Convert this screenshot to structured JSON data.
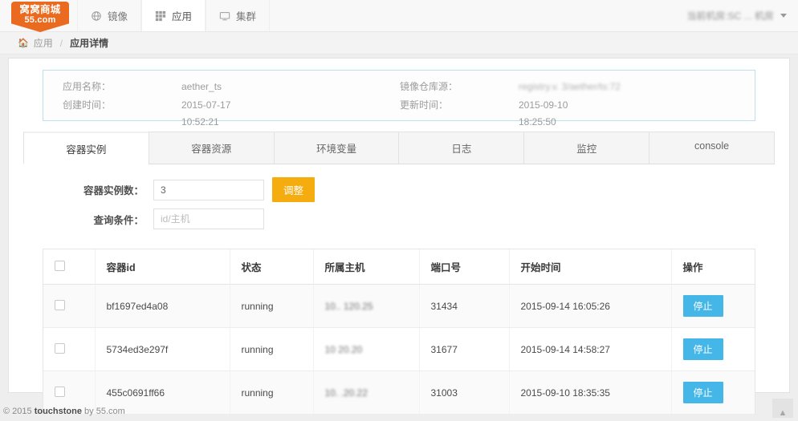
{
  "navbar": {
    "logo": {
      "line1": "窝窝商城",
      "line2": "55.com",
      "color": "#ea6a1f"
    },
    "items": [
      {
        "label": "镜像",
        "icon": "globe-icon",
        "active": false
      },
      {
        "label": "应用",
        "icon": "apps-grid-icon",
        "active": true
      },
      {
        "label": "集群",
        "icon": "monitor-icon",
        "active": false
      }
    ],
    "right": {
      "label": "当前机房:SC ... 机房",
      "icon": "chevron-down-icon"
    }
  },
  "breadcrumb": {
    "home_icon": "home-icon",
    "parent": "应用",
    "separator": "/",
    "current": "应用详情"
  },
  "info_panel": {
    "app_name_label": "应用名称：",
    "app_name_value": "aether_ts",
    "registry_label": "镜像仓库源：",
    "registry_value": "registry.v.                3/aether/ts:72",
    "created_label": "创建时间：",
    "created_value": "2015-07-17",
    "created_value_time": "10:52:21",
    "updated_label": "更新时间：",
    "updated_value": "2015-09-10",
    "updated_value_time": "18:25:50",
    "border_color": "#bcdff1"
  },
  "tabs": [
    {
      "label": "容器实例",
      "active": true
    },
    {
      "label": "容器资源",
      "active": false
    },
    {
      "label": "环境变量",
      "active": false
    },
    {
      "label": "日志",
      "active": false
    },
    {
      "label": "监控",
      "active": false
    },
    {
      "label": "console",
      "active": false
    }
  ],
  "form": {
    "instances_label": "容器实例数：",
    "instances_value": "3",
    "adjust_button": "调整",
    "adjust_button_color": "#f5ac0e",
    "query_label": "查询条件：",
    "query_value": "",
    "query_placeholder": "id/主机"
  },
  "table": {
    "headers": [
      "",
      "容器id",
      "状态",
      "所属主机",
      "端口号",
      "开始时间",
      "操作"
    ],
    "rows": [
      {
        "container_id": "bf1697ed4a08",
        "state": "running",
        "host": "10.. 120.25",
        "port": "31434",
        "start_time": "2015-09-14 16:05:26",
        "action": "停止"
      },
      {
        "container_id": "5734ed3e297f",
        "state": "running",
        "host": "10     20.20",
        "port": "31677",
        "start_time": "2015-09-14 14:58:27",
        "action": "停止"
      },
      {
        "container_id": "455c0691ff66",
        "state": "running",
        "host": "10.  .20.22",
        "port": "31003",
        "start_time": "2015-09-10 18:35:35",
        "action": "停止"
      }
    ],
    "action_button_color": "#45b6e8"
  },
  "footer": {
    "prefix": "© 2015 ",
    "brand": "touchstone",
    "suffix": " by 55.com",
    "scroll_top_icon": "chevron-up-icon"
  }
}
